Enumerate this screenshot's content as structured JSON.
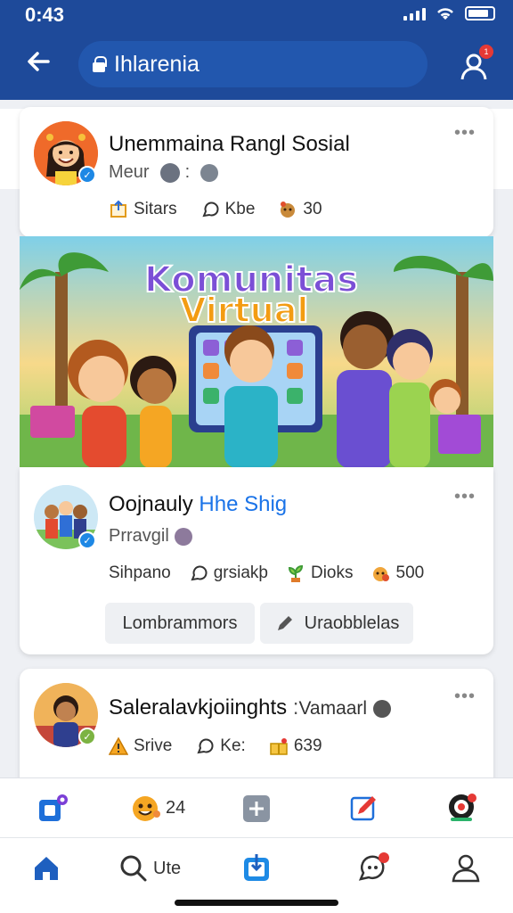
{
  "status_bar": {
    "time": "0:43"
  },
  "header": {
    "title": "Ihlarenia",
    "notification_badge": "1"
  },
  "posts": [
    {
      "name": "Unemmaina Rangl Sosial",
      "subtitle": "Meur",
      "actions": [
        {
          "icon": "share-icon",
          "label": "Sitars"
        },
        {
          "icon": "comment-icon",
          "label": "Kbe"
        },
        {
          "icon": "reaction-icon",
          "label": "30"
        }
      ]
    },
    {
      "name_part1": "Oojnauly",
      "name_part2": "Hhe Shig",
      "subtitle": "Prravgil",
      "actions": [
        {
          "icon": "",
          "label": "Sihpano"
        },
        {
          "icon": "comment-icon",
          "label": "grsiakþ"
        },
        {
          "icon": "plant-icon",
          "label": "Dioks"
        },
        {
          "icon": "reaction-icon",
          "label": "500"
        }
      ],
      "buttons": [
        {
          "label": "Lombrammors"
        },
        {
          "label": "Uraobblelas"
        }
      ]
    },
    {
      "name": "Saleralavkjoiinghts",
      "name_suffix": "Vamaarl",
      "actions": [
        {
          "icon": "warning-icon",
          "label": "Srive"
        },
        {
          "icon": "comment-icon",
          "label": "Ke:"
        },
        {
          "icon": "gift-icon",
          "label": "639"
        }
      ]
    }
  ],
  "banner": {
    "title_line1": "Komunitas",
    "title_line2": "Virtual"
  },
  "tab_bar_top": [
    {
      "icon": "feed-icon",
      "label": ""
    },
    {
      "icon": "emoji-icon",
      "label": "24"
    },
    {
      "icon": "add-icon",
      "label": ""
    },
    {
      "icon": "edit-icon",
      "label": ""
    },
    {
      "icon": "target-icon",
      "label": ""
    }
  ],
  "tab_bar_bottom": [
    {
      "icon": "home-icon",
      "label": ""
    },
    {
      "icon": "search-icon",
      "label": "Ute"
    },
    {
      "icon": "upload-icon",
      "label": ""
    },
    {
      "icon": "chat-icon",
      "label": ""
    },
    {
      "icon": "profile-icon",
      "label": ""
    }
  ],
  "colors": {
    "brand": "#1e4a9a",
    "accent": "#1a73e8",
    "badge": "#e53935",
    "verified": "#1e88e5"
  }
}
